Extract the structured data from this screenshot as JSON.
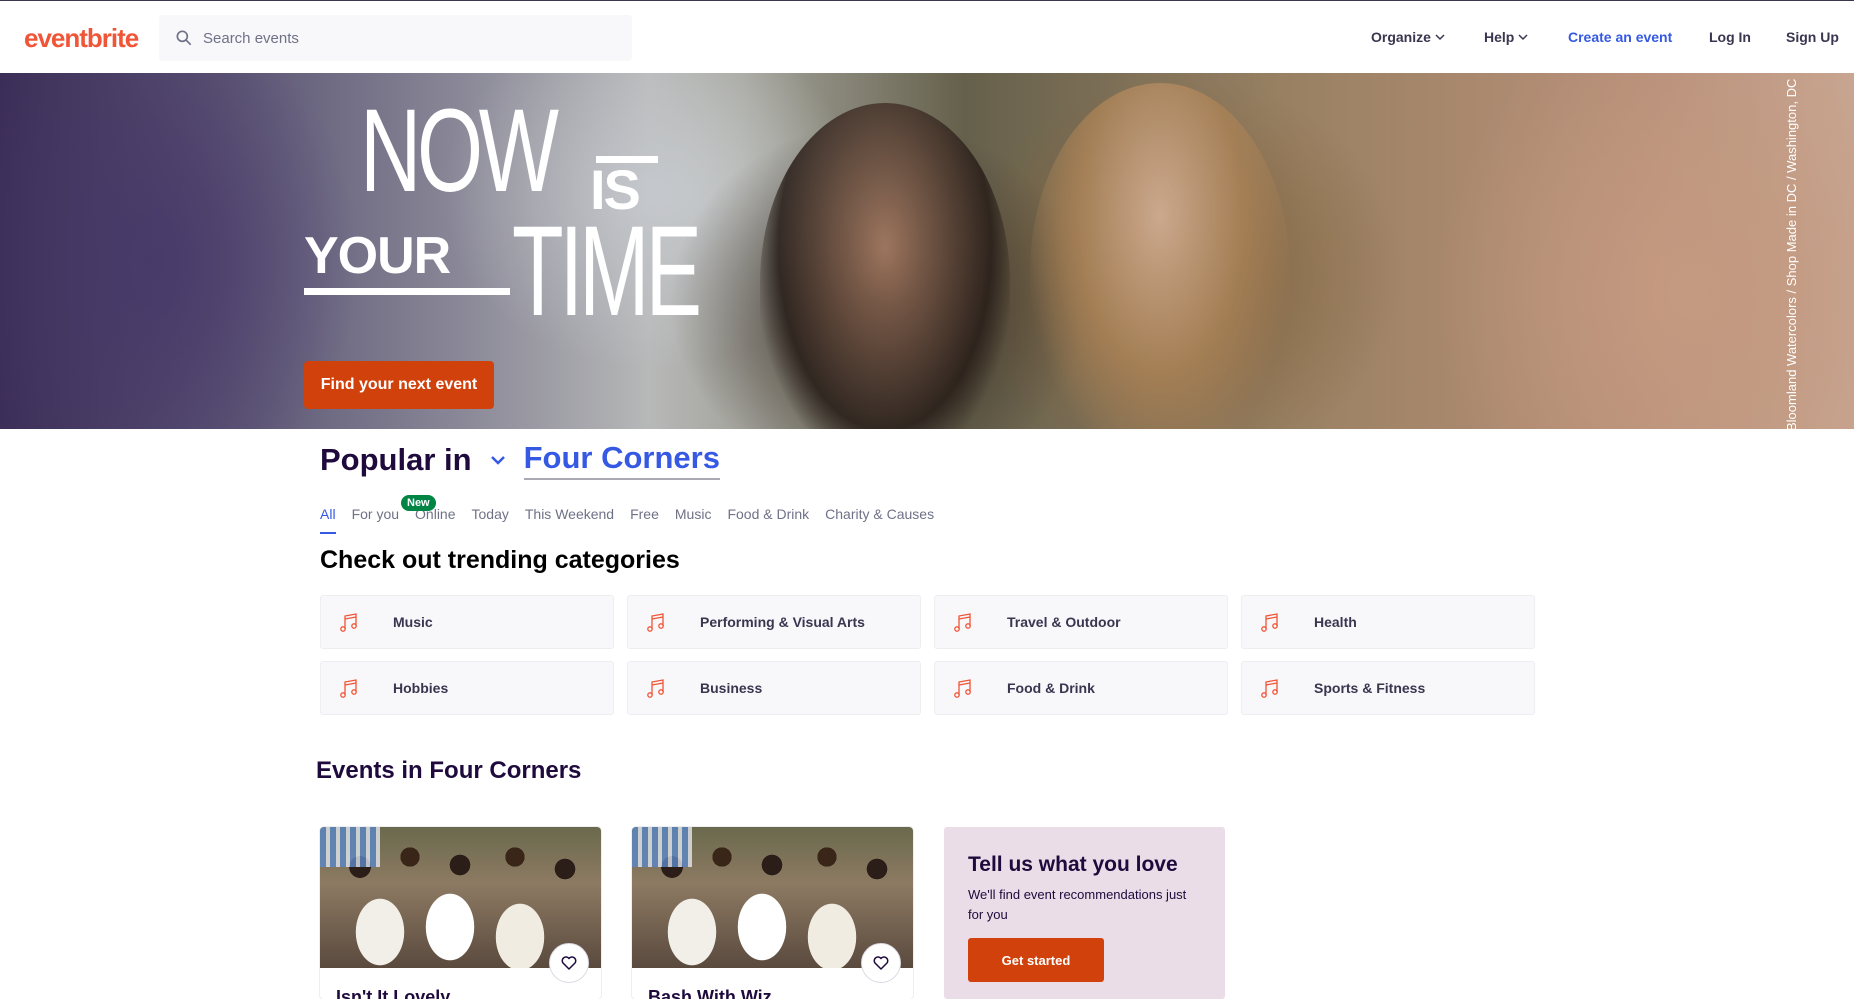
{
  "header": {
    "logo": "eventbrite",
    "search_placeholder": "Search events",
    "nav": {
      "organize": "Organize",
      "help": "Help",
      "create_event": "Create an event",
      "log_in": "Log In",
      "sign_up": "Sign Up"
    }
  },
  "hero": {
    "headline_now": "NOW",
    "headline_is": "IS",
    "headline_your": "YOUR",
    "headline_time": "TIME",
    "cta_label": "Find your next event",
    "photo_caption": "Bloomland Watercolors / Shop Made in DC / Washington, DC"
  },
  "popular": {
    "label": "Popular in",
    "location": "Four Corners"
  },
  "tabs": [
    {
      "label": "All",
      "active": true
    },
    {
      "label": "For you"
    },
    {
      "label": "Online"
    },
    {
      "label": "Today"
    },
    {
      "label": "This Weekend"
    },
    {
      "label": "Free"
    },
    {
      "label": "Music"
    },
    {
      "label": "Food & Drink"
    },
    {
      "label": "Charity & Causes"
    }
  ],
  "new_badge": "New",
  "categories_title": "Check out trending categories",
  "categories": [
    {
      "label": "Music",
      "icon": "music-note-icon"
    },
    {
      "label": "Performing & Visual Arts",
      "icon": "music-note-icon"
    },
    {
      "label": "Travel & Outdoor",
      "icon": "music-note-icon"
    },
    {
      "label": "Health",
      "icon": "music-note-icon"
    },
    {
      "label": "Hobbies",
      "icon": "music-note-icon"
    },
    {
      "label": "Business",
      "icon": "music-note-icon"
    },
    {
      "label": "Food & Drink",
      "icon": "music-note-icon"
    },
    {
      "label": "Sports & Fitness",
      "icon": "music-note-icon"
    }
  ],
  "events_title": "Events in Four Corners",
  "event_cards": [
    {
      "title": "Isn't It Lovely"
    },
    {
      "title": "Bash With Wiz"
    }
  ],
  "promo": {
    "title": "Tell us what you love",
    "description": "We'll find event recommendations just for you",
    "button": "Get started"
  },
  "colors": {
    "brand": "#f05537",
    "accent_blue": "#3659e3",
    "cta": "#d1410c",
    "badge_green": "#008545",
    "promo_bg": "#ebdde8"
  }
}
